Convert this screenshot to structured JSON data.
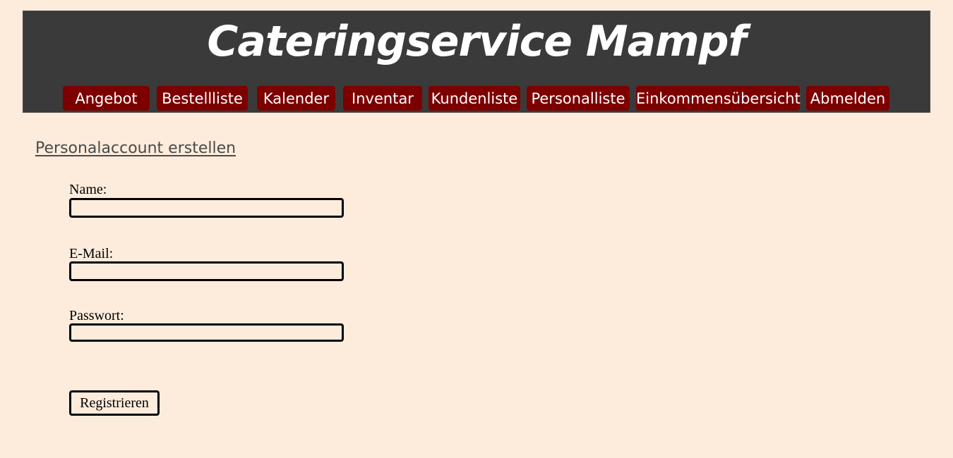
{
  "header": {
    "title": "Cateringservice Mampf"
  },
  "nav": {
    "items": [
      {
        "label": "Angebot"
      },
      {
        "label": "Bestellliste"
      },
      {
        "label": "Kalender"
      },
      {
        "label": "Inventar"
      },
      {
        "label": "Kundenliste"
      },
      {
        "label": "Personalliste"
      },
      {
        "label": "Einkommensübersicht"
      },
      {
        "label": "Abmelden"
      }
    ]
  },
  "main": {
    "section_title": "Personalaccount erstellen",
    "form": {
      "name_label": "Name:",
      "name_value": "",
      "email_label": "E-Mail:",
      "email_value": "",
      "password_label": "Passwort:",
      "password_value": "",
      "submit_label": "Registrieren"
    }
  },
  "colors": {
    "page_background": "#FDECDC",
    "header_background": "#3A3A3A",
    "nav_item_background": "#7D0000",
    "nav_text": "#FFFFFF",
    "section_title": "#4A4A4A"
  }
}
